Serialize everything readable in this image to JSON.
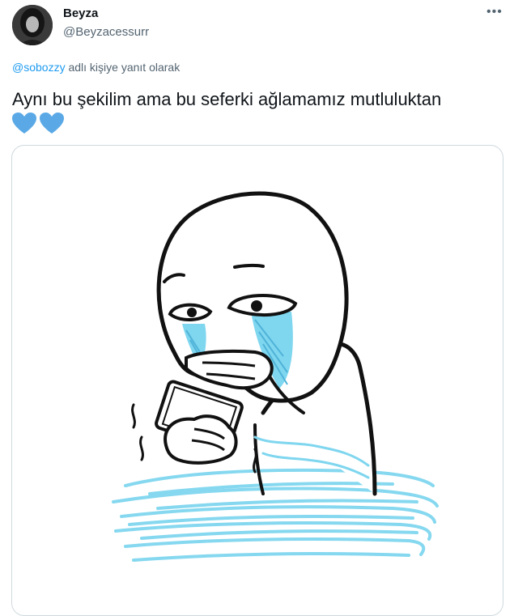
{
  "tweet": {
    "display_name": "Beyza",
    "handle": "@Beyzacessurr",
    "more_icon": "more-horizontal-icon",
    "reply_to": {
      "mention": "@sobozzy",
      "suffix": " adlı kişiye yanıt olarak"
    },
    "text": "Aynı bu şekilim ama bu seferki ağlamamız mutluluktan",
    "emojis": [
      "blue-heart-icon",
      "blue-heart-icon"
    ]
  },
  "colors": {
    "accent": "#1d9bf0",
    "text": "#0f1419",
    "muted": "#536471",
    "heart": "#5aa9e6",
    "tears": "#7fd6ef",
    "border": "#cfd9de"
  },
  "media": {
    "type": "image",
    "subject": "crying-meme-figure-with-phone-icon"
  }
}
